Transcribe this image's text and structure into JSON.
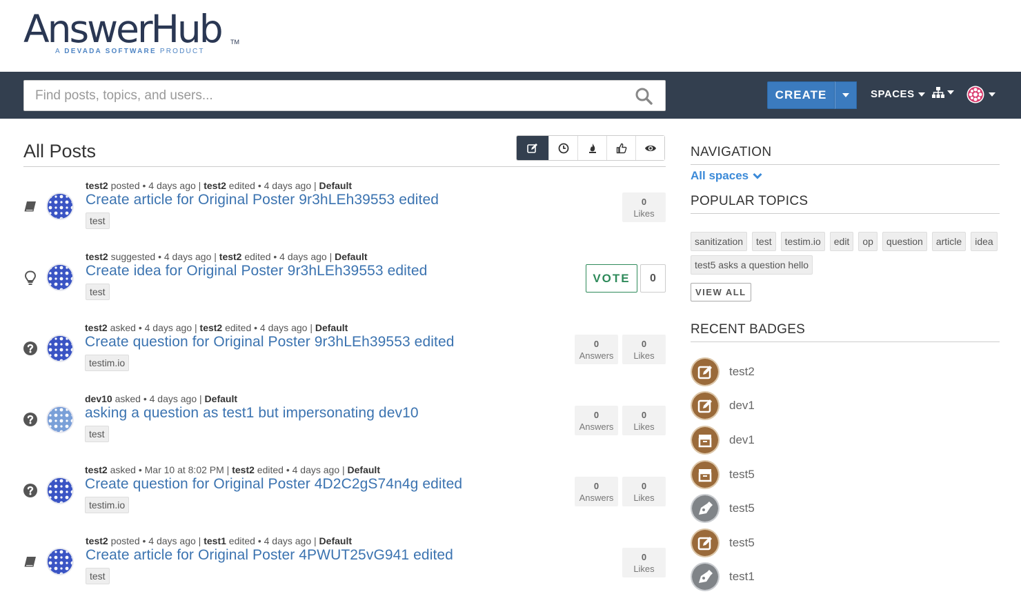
{
  "logo": {
    "title": "AnswerHub",
    "tm": "TM",
    "subtitle_prefix": "A ",
    "subtitle_brand": "DEVADA SOFTWARE",
    "subtitle_suffix": " PRODUCT"
  },
  "search": {
    "placeholder": "Find posts, topics, and users..."
  },
  "nav": {
    "create_label": "CREATE",
    "spaces_label": "SPACES"
  },
  "main": {
    "title": "All Posts",
    "sort_icons": [
      "edit-sort-icon",
      "clock-sort-icon",
      "fire-sort-icon",
      "thumbs-up-sort-icon",
      "eye-sort-icon"
    ],
    "posts": [
      {
        "type": "article",
        "meta": [
          [
            "test2",
            " posted • 4 days ago | "
          ],
          [
            "test2",
            " edited • 4 days ago | "
          ],
          [
            "Default",
            ""
          ]
        ],
        "title": "Create article for Original Poster 9r3hLEh39553 edited",
        "tag": "test",
        "likes": "0",
        "likes_label": "Likes"
      },
      {
        "type": "idea",
        "meta": [
          [
            "test2",
            " suggested • 4 days ago | "
          ],
          [
            "test2",
            " edited • 4 days ago | "
          ],
          [
            "Default",
            ""
          ]
        ],
        "title": "Create idea for Original Poster 9r3hLEh39553 edited",
        "tag": "test",
        "vote_label": "VOTE",
        "votes": "0"
      },
      {
        "type": "question",
        "meta": [
          [
            "test2",
            " asked • 4 days ago | "
          ],
          [
            "test2",
            " edited • 4 days ago | "
          ],
          [
            "Default",
            ""
          ]
        ],
        "title": "Create question for Original Poster 9r3hLEh39553 edited",
        "tag": "testim.io",
        "answers": "0",
        "answers_label": "Answers",
        "likes": "0",
        "likes_label": "Likes"
      },
      {
        "type": "question",
        "meta": [
          [
            "dev10",
            " asked • 4 days ago | "
          ],
          [
            "Default",
            ""
          ]
        ],
        "title": "asking a question as test1 but impersonating dev10",
        "tag": "test",
        "answers": "0",
        "answers_label": "Answers",
        "likes": "0",
        "likes_label": "Likes"
      },
      {
        "type": "question",
        "meta": [
          [
            "test2",
            " asked • Mar 10 at 8:02 PM | "
          ],
          [
            "test2",
            " edited • 4 days ago | "
          ],
          [
            "Default",
            ""
          ]
        ],
        "title": "Create question for Original Poster 4D2C2gS74n4g edited",
        "tag": "testim.io",
        "answers": "0",
        "answers_label": "Answers",
        "likes": "0",
        "likes_label": "Likes"
      },
      {
        "type": "article",
        "meta": [
          [
            "test2",
            " posted • 4 days ago | "
          ],
          [
            "test1",
            " edited • 4 days ago | "
          ],
          [
            "Default",
            ""
          ]
        ],
        "title": "Create article for Original Poster 4PWUT25vG941 edited",
        "tag": "test",
        "likes": "0",
        "likes_label": "Likes"
      }
    ]
  },
  "sidebar": {
    "navigation_heading": "NAVIGATION",
    "all_spaces": "All spaces",
    "popular_heading": "POPULAR TOPICS",
    "topics": [
      "sanitization",
      "test",
      "testim.io",
      "edit",
      "op",
      "question",
      "article",
      "idea",
      "test5 asks a question hello"
    ],
    "view_all": "VIEW ALL",
    "badges_heading": "RECENT BADGES",
    "badges": [
      {
        "name": "test2",
        "icon": "edit-badge-icon"
      },
      {
        "name": "dev1",
        "icon": "edit-badge-icon"
      },
      {
        "name": "dev1",
        "icon": "archive-badge-icon"
      },
      {
        "name": "test5",
        "icon": "archive-badge-icon"
      },
      {
        "name": "test5",
        "icon": "pen-badge-icon"
      },
      {
        "name": "test5",
        "icon": "edit-badge-icon"
      },
      {
        "name": "test1",
        "icon": "pen-badge-icon"
      }
    ]
  },
  "colors": {
    "navbar": "#333f4f",
    "accent": "#3b7bbf",
    "link": "#3b73b0",
    "vote": "#2e8a5a",
    "badge_bronze": "#9a6a3a"
  }
}
